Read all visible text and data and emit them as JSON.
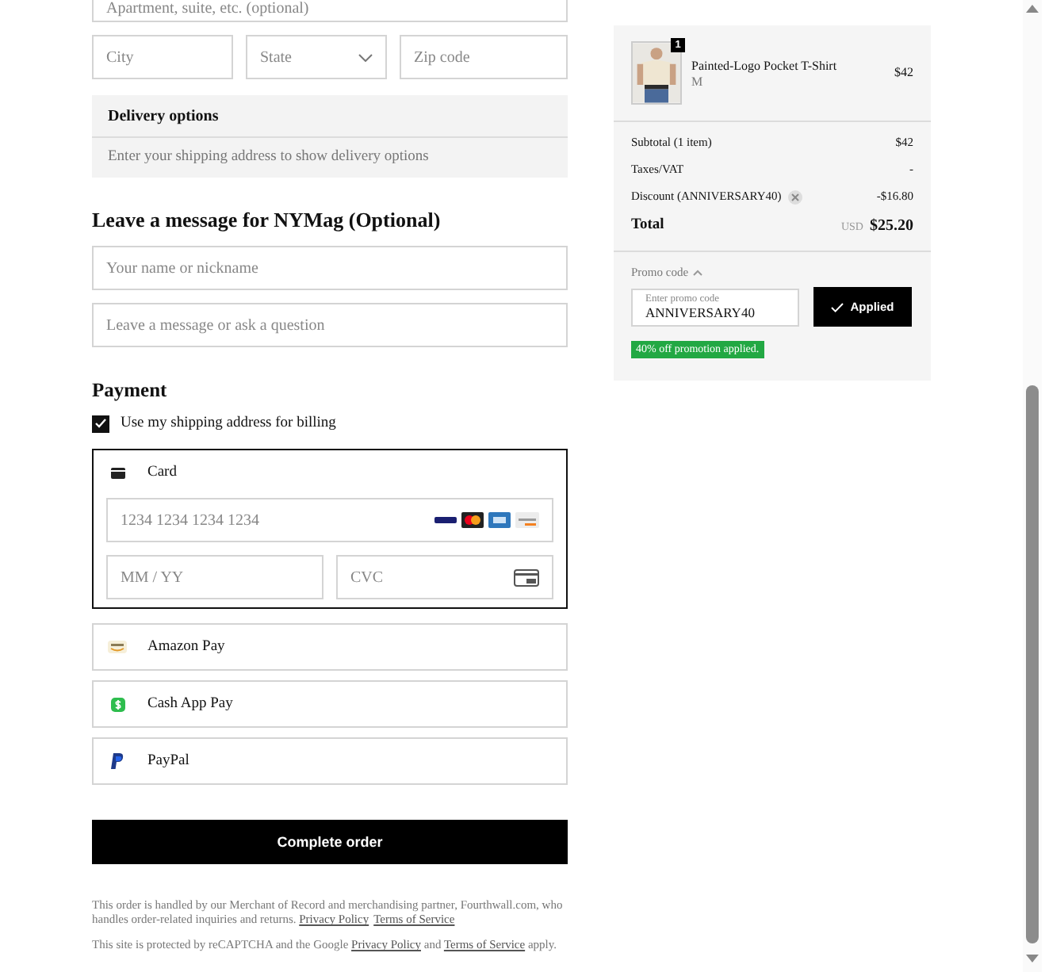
{
  "address": {
    "apartment_placeholder": "Apartment, suite, etc. (optional)",
    "city_placeholder": "City",
    "state_placeholder": "State",
    "zip_placeholder": "Zip code"
  },
  "delivery": {
    "title": "Delivery options",
    "message": "Enter your shipping address to show delivery options"
  },
  "message_section": {
    "title": "Leave a message for NYMag (Optional)",
    "name_placeholder": "Your name or nickname",
    "message_placeholder": "Leave a message or ask a question"
  },
  "payment": {
    "title": "Payment",
    "billing_same": {
      "label": "Use my shipping address for billing",
      "checked": true
    },
    "methods": [
      {
        "kind": "card",
        "label": "Card",
        "selected": true,
        "number_placeholder": "1234 1234 1234 1234",
        "expiry_placeholder": "MM / YY",
        "cvc_placeholder": "CVC"
      },
      {
        "kind": "amazon",
        "label": "Amazon Pay",
        "selected": false
      },
      {
        "kind": "cashapp",
        "label": "Cash App Pay",
        "selected": false
      },
      {
        "kind": "paypal",
        "label": "PayPal",
        "selected": false
      }
    ]
  },
  "submit": "Complete order",
  "legal": [
    [
      {
        "kind": "text",
        "text": "This order is handled by our Merchant of Record and merchandising partner, Fourthwall.com, who handles order-related inquiries and returns. "
      },
      {
        "kind": "link",
        "text": "Privacy Policy"
      },
      {
        "kind": "link",
        "text": "Terms of Service"
      }
    ],
    [
      {
        "kind": "text",
        "text": "This site is protected by reCAPTCHA and the Google "
      },
      {
        "kind": "link",
        "text": "Privacy Policy"
      },
      {
        "kind": "text",
        "text": " and "
      },
      {
        "kind": "link",
        "text": "Terms of Service"
      },
      {
        "kind": "text",
        "text": " apply."
      }
    ]
  ],
  "summary": {
    "items": [
      {
        "name": "Painted-Logo Pocket T-Shirt",
        "variant": "M",
        "price": "$42",
        "quantity": "1"
      }
    ],
    "lines": [
      {
        "label": "Subtotal (1 item)",
        "value": "$42"
      },
      {
        "label": "Taxes/VAT",
        "value": "-"
      },
      {
        "label": "Discount (ANNIVERSARY40)",
        "value": "-$16.80",
        "removable": true
      }
    ],
    "total": {
      "label": "Total",
      "currency": "USD",
      "value": "$25.20"
    },
    "promo": {
      "title": "Promo code",
      "expanded": true,
      "field_label": "Enter promo code",
      "value": "ANNIVERSARY40",
      "button": "Applied",
      "applied": true,
      "message": "40% off promotion applied."
    }
  }
}
